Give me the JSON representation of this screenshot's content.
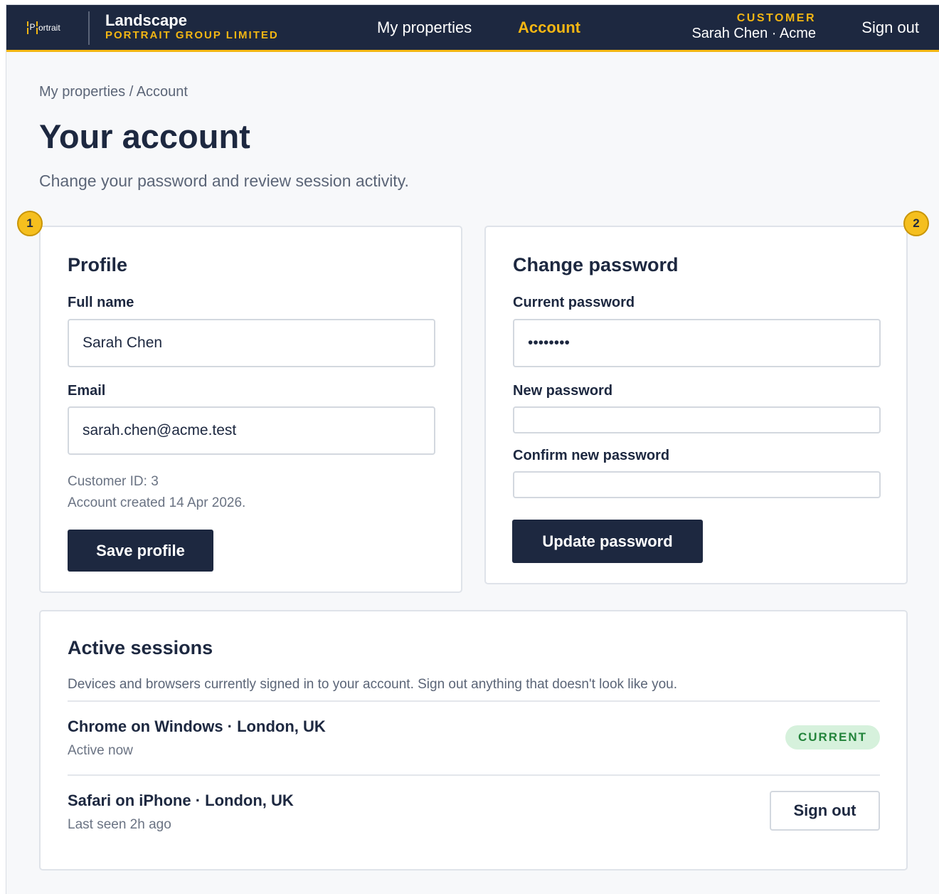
{
  "header": {
    "logo_text": "ortrait",
    "logo_letter": "P",
    "brand_name": "Landscape",
    "brand_sub": "PORTRAIT GROUP LIMITED",
    "nav": [
      {
        "label": "My properties",
        "active": false
      },
      {
        "label": "Account",
        "active": true
      }
    ],
    "user_role": "CUSTOMER",
    "user_name": "Sarah Chen · Acme",
    "sign_out": "Sign out"
  },
  "page": {
    "breadcrumb": "My properties / Account",
    "title": "Your account",
    "subtitle": "Change your password and review session activity."
  },
  "markers": [
    "1",
    "2"
  ],
  "profile": {
    "title": "Profile",
    "full_name_label": "Full name",
    "full_name_value": "Sarah Chen",
    "email_label": "Email",
    "email_value": "sarah.chen@acme.test",
    "customer_id": "Customer ID: 3",
    "created": "Account created 14 Apr 2026.",
    "save_label": "Save profile"
  },
  "password": {
    "title": "Change password",
    "current_label": "Current password",
    "current_value": "••••••••",
    "new_label": "New password",
    "new_value": "",
    "confirm_label": "Confirm new password",
    "confirm_value": "",
    "update_label": "Update password"
  },
  "sessions": {
    "title": "Active sessions",
    "description": "Devices and browsers currently signed in to your account. Sign out anything that doesn't look like you.",
    "items": [
      {
        "name": "Chrome on Windows · London, UK",
        "time": "Active now",
        "badge": "CURRENT"
      },
      {
        "name": "Safari on iPhone · London, UK",
        "time": "Last seen 2h ago",
        "action": "Sign out"
      }
    ]
  },
  "colors": {
    "navy": "#1d2840",
    "accent": "#f3b613",
    "current_badge_bg": "#d6f1dc",
    "current_badge_text": "#23843b"
  }
}
